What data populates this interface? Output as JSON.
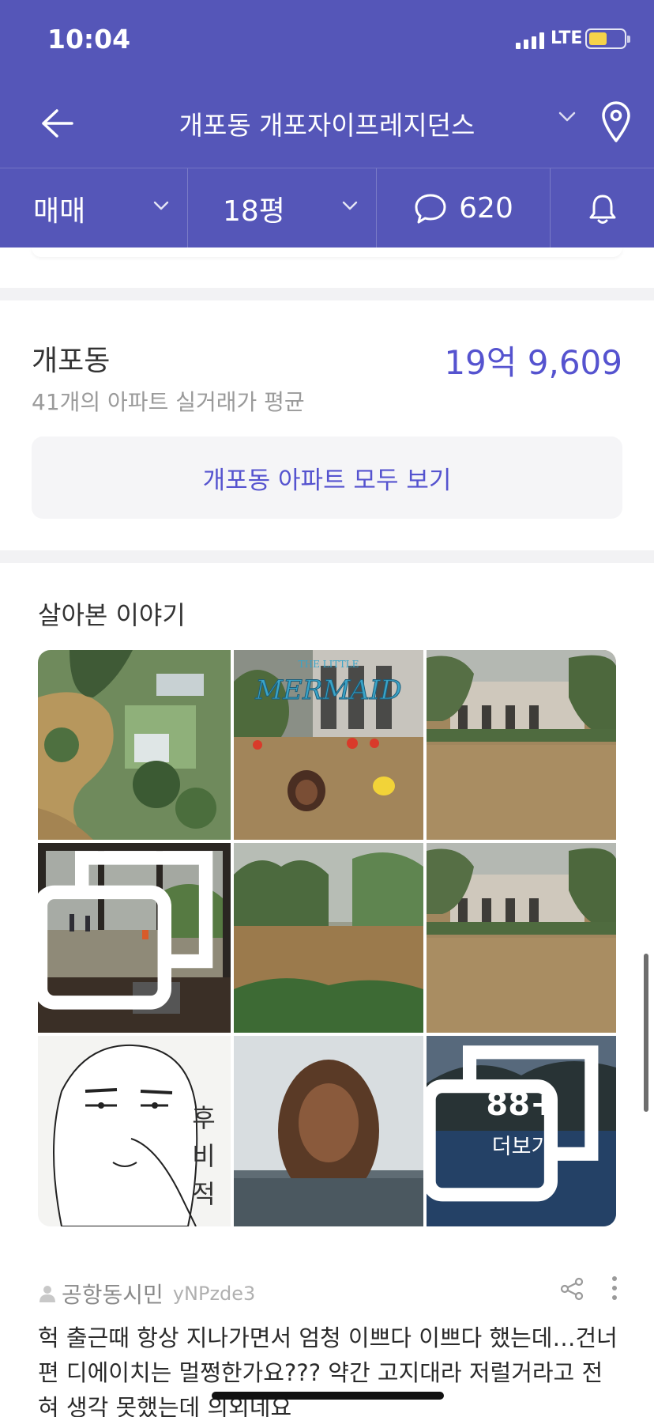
{
  "status_bar": {
    "time": "10:04",
    "network": "LTE",
    "battery_level": 0.5
  },
  "nav": {
    "title": "개포동 개포자이프레지던스",
    "back_icon": "back-arrow-icon",
    "location_icon": "map-pin-icon"
  },
  "tabs": {
    "deal_type": "매매",
    "size": "18평",
    "comment_count": "620",
    "comment_icon": "chat-bubble-icon",
    "bell_icon": "bell-icon"
  },
  "average": {
    "area_name": "개포동",
    "price": "19억 9,609",
    "description": "41개의 아파트 실거래가 평균",
    "view_all_label": "개포동 아파트 모두 보기"
  },
  "stories": {
    "title": "살아본 이야기",
    "photos": [
      {
        "subject": "flooded garden aerial view"
      },
      {
        "subject": "mermaid meme over flooded street",
        "caption": "THE LITTLE MERMAID"
      },
      {
        "subject": "flooded courtyard"
      },
      {
        "subject": "flooded lobby through windows",
        "multi": true
      },
      {
        "subject": "muddy flood water with trees"
      },
      {
        "subject": "flooded courtyard"
      },
      {
        "subject": "cartoon meme",
        "caption": "후비적"
      },
      {
        "subject": "person in water"
      },
      {
        "subject": "lake view",
        "more_count": "88+",
        "more_label": "더보기",
        "multi": true
      }
    ]
  },
  "post": {
    "author": "공항동시민",
    "author_id": "yNPzde3",
    "body": "헉 출근때 항상 지나가면서 엄청 이쁘다 이쁘다 했는데…건너편 디에이치는 멀쩡한가요??? 약간 고지대라 저럴거라고 전혀 생각 못했는데 의외네요"
  },
  "colors": {
    "brand": "#5556b8",
    "accent": "#5553cf"
  }
}
